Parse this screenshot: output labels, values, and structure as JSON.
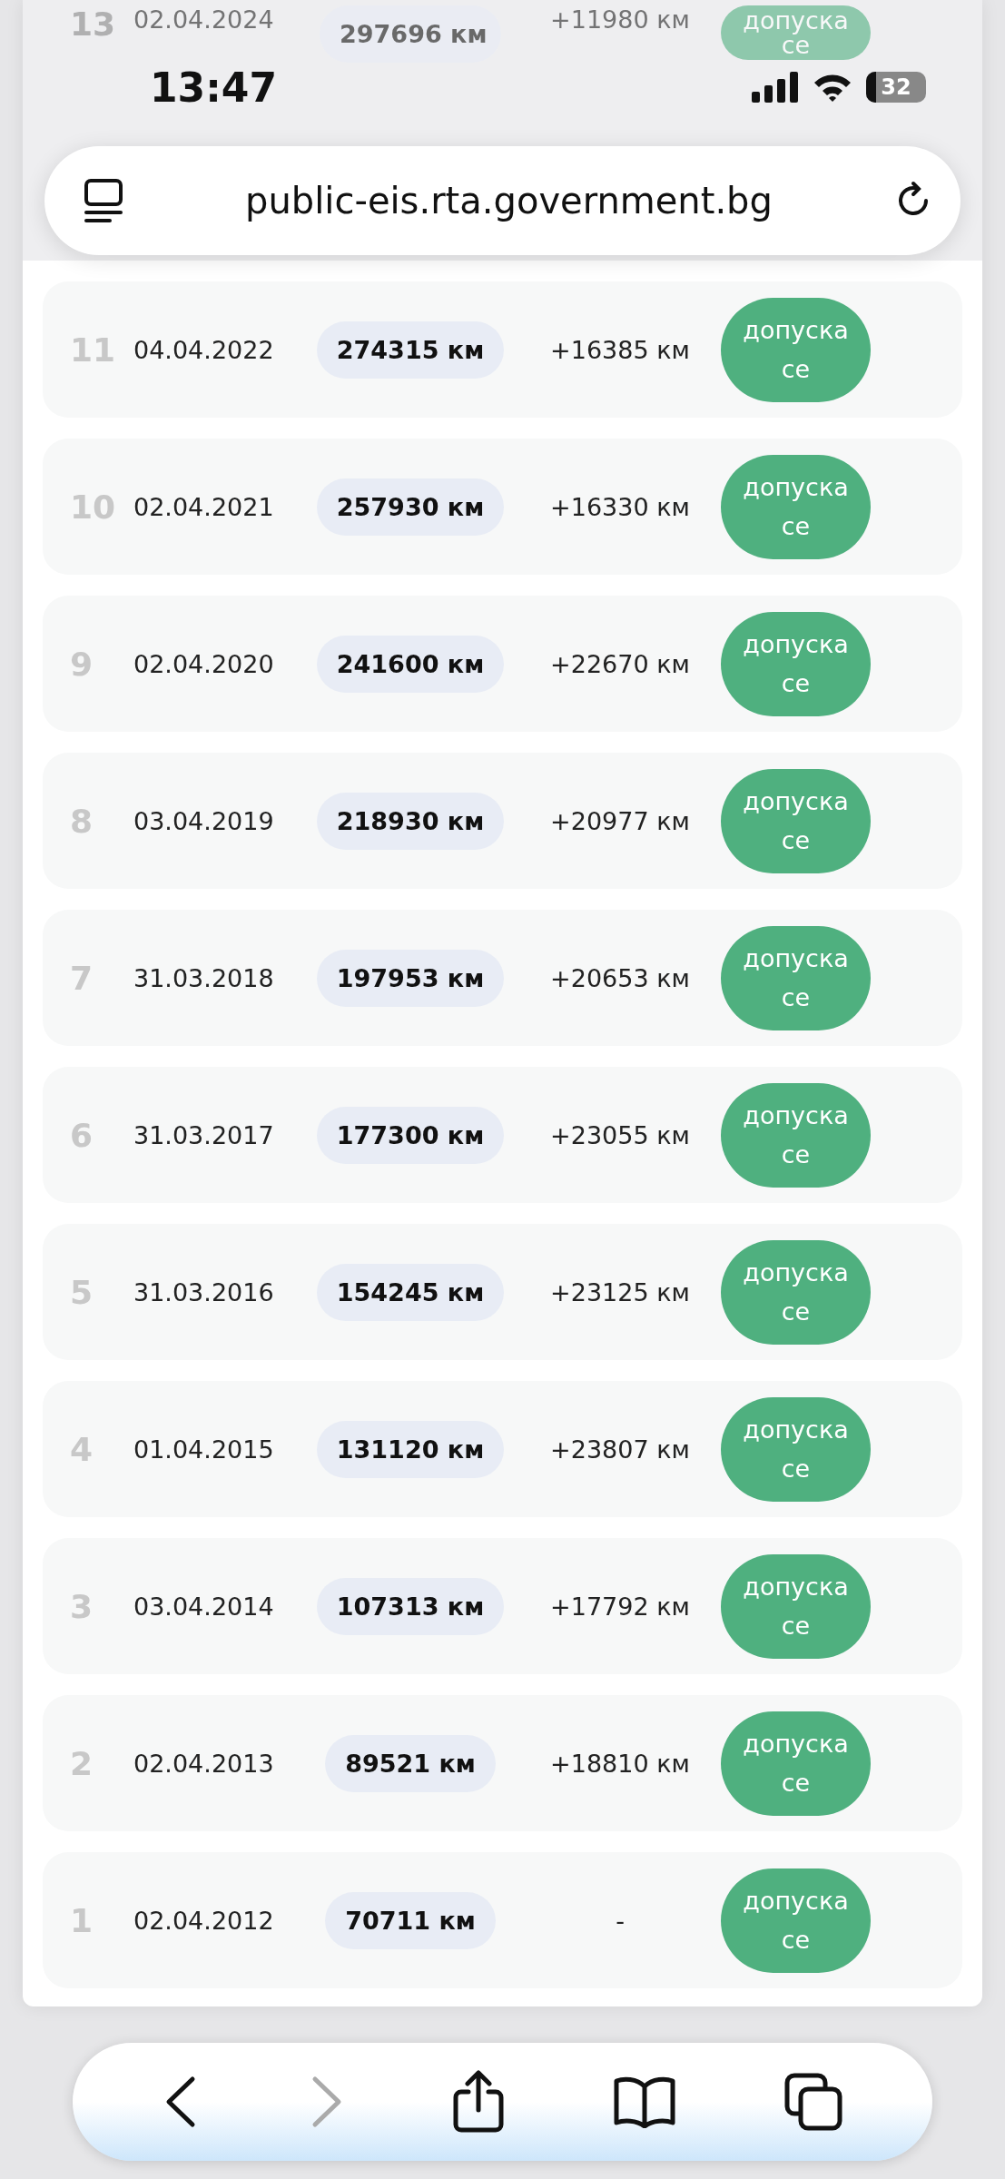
{
  "status_bar": {
    "time": "13:47",
    "battery": "32"
  },
  "address_bar": {
    "url": "public-eis.rta.government.bg"
  },
  "rows": [
    {
      "number": "13",
      "date": "02.04.2024",
      "mileage": "297696 км",
      "delta": "+11980 км",
      "status": "допуска се",
      "dimmed": true
    },
    {
      "number": "11",
      "date": "04.04.2022",
      "mileage": "274315 км",
      "delta": "+16385 км",
      "status": "допуска се",
      "dimmed": false
    },
    {
      "number": "10",
      "date": "02.04.2021",
      "mileage": "257930 км",
      "delta": "+16330 км",
      "status": "допуска се",
      "dimmed": false
    },
    {
      "number": "9",
      "date": "02.04.2020",
      "mileage": "241600 км",
      "delta": "+22670 км",
      "status": "допуска се",
      "dimmed": false
    },
    {
      "number": "8",
      "date": "03.04.2019",
      "mileage": "218930 км",
      "delta": "+20977 км",
      "status": "допуска се",
      "dimmed": false
    },
    {
      "number": "7",
      "date": "31.03.2018",
      "mileage": "197953 км",
      "delta": "+20653 км",
      "status": "допуска се",
      "dimmed": false
    },
    {
      "number": "6",
      "date": "31.03.2017",
      "mileage": "177300 км",
      "delta": "+23055 км",
      "status": "допуска се",
      "dimmed": false
    },
    {
      "number": "5",
      "date": "31.03.2016",
      "mileage": "154245 км",
      "delta": "+23125 км",
      "status": "допуска се",
      "dimmed": false
    },
    {
      "number": "4",
      "date": "01.04.2015",
      "mileage": "131120 км",
      "delta": "+23807 км",
      "status": "допуска се",
      "dimmed": false
    },
    {
      "number": "3",
      "date": "03.04.2014",
      "mileage": "107313 км",
      "delta": "+17792 км",
      "status": "допуска се",
      "dimmed": false
    },
    {
      "number": "2",
      "date": "02.04.2013",
      "mileage": "89521 км",
      "delta": "+18810 км",
      "status": "допуска се",
      "dimmed": false
    },
    {
      "number": "1",
      "date": "02.04.2012",
      "mileage": "70711 км",
      "delta": "-",
      "status": "допуска се",
      "dimmed": false
    }
  ]
}
